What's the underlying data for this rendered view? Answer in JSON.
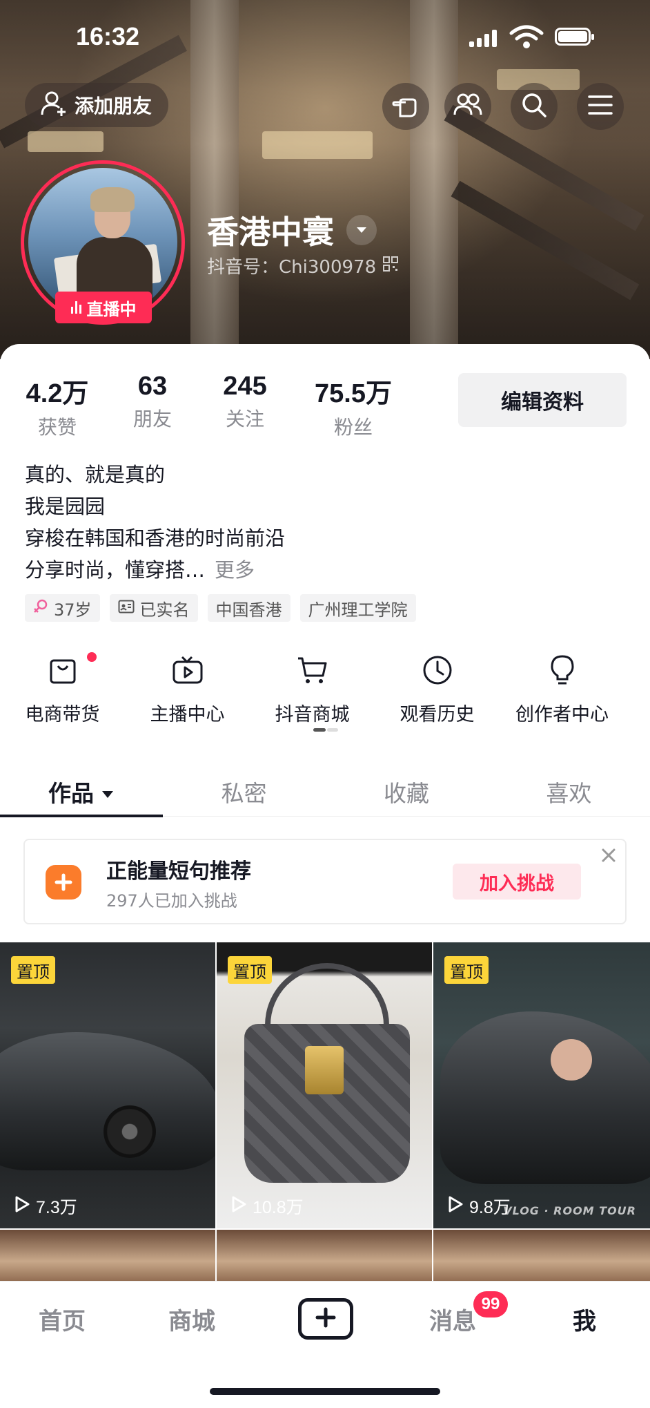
{
  "status_bar": {
    "time": "16:32"
  },
  "header": {
    "add_friend_label": "添加朋友",
    "nickname": "香港中寰",
    "douyin_id": "抖音号：Chi300978",
    "live_badge": "直播中"
  },
  "stats": [
    {
      "value": "4.2万",
      "label": "获赞"
    },
    {
      "value": "63",
      "label": "朋友"
    },
    {
      "value": "245",
      "label": "关注"
    },
    {
      "value": "75.5万",
      "label": "粉丝"
    }
  ],
  "edit_profile_label": "编辑资料",
  "bio": {
    "lines": [
      "真的、就是真的",
      "我是园园",
      "穿梭在韩国和香港的时尚前沿",
      "分享时尚，懂穿搭…"
    ],
    "more_label": "更多"
  },
  "tags": [
    "37岁",
    "已实名",
    "中国香港",
    "广州理工学院"
  ],
  "shortcuts": [
    "电商带货",
    "主播中心",
    "抖音商城",
    "观看历史",
    "创作者中心"
  ],
  "tabs": [
    "作品",
    "私密",
    "收藏",
    "喜欢"
  ],
  "challenge": {
    "title": "正能量短句推荐",
    "subtitle": "297人已加入挑战",
    "join_label": "加入挑战"
  },
  "videos": [
    {
      "pinned_label": "置顶",
      "views": "7.3万"
    },
    {
      "pinned_label": "置顶",
      "views": "10.8万"
    },
    {
      "pinned_label": "置顶",
      "views": "9.8万",
      "overlay_text": "VLOG · ROOM TOUR"
    }
  ],
  "bottom_nav": {
    "home": "首页",
    "mall": "商城",
    "messages": "消息",
    "messages_badge": "99",
    "me": "我"
  },
  "colors": {
    "accent": "#fe2c55",
    "pin": "#fcd53a",
    "challenge_icon": "#fb7c2b"
  }
}
